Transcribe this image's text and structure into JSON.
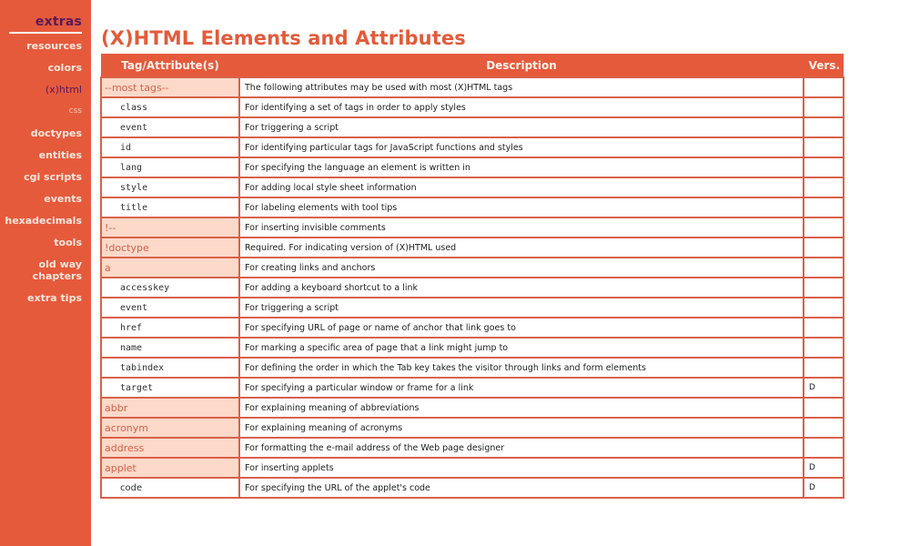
{
  "sidebar": {
    "current": "extras",
    "items": [
      {
        "label": "resources",
        "style": "normal"
      },
      {
        "label": "colors",
        "style": "normal"
      },
      {
        "label": "(x)html",
        "style": "active"
      },
      {
        "label": "css",
        "style": "small"
      },
      {
        "label": "doctypes",
        "style": "normal"
      },
      {
        "label": "entities",
        "style": "normal"
      },
      {
        "label": "cgi scripts",
        "style": "normal"
      },
      {
        "label": "events",
        "style": "normal"
      },
      {
        "label": "hexadecimals",
        "style": "normal"
      },
      {
        "label": "tools",
        "style": "normal"
      },
      {
        "label": "old way chapters",
        "style": "normal"
      },
      {
        "label": "extra tips",
        "style": "normal"
      }
    ]
  },
  "page": {
    "title": "(X)HTML Elements and Attributes"
  },
  "table": {
    "headers": [
      "Tag/Attribute(s)",
      "Description",
      "Vers."
    ],
    "rows": [
      {
        "name": "--most tags--",
        "kind": "tag",
        "desc": "The following attributes may be used with most (X)HTML tags",
        "vers": ""
      },
      {
        "name": "class",
        "kind": "attr",
        "desc": "For identifying a set of tags in order to apply styles",
        "vers": ""
      },
      {
        "name": "event",
        "kind": "attr",
        "desc": "For triggering a script",
        "vers": ""
      },
      {
        "name": "id",
        "kind": "attr",
        "desc": "For identifying particular tags for JavaScript functions and styles",
        "vers": ""
      },
      {
        "name": "lang",
        "kind": "attr",
        "desc": "For specifying the language an element is written in",
        "vers": ""
      },
      {
        "name": "style",
        "kind": "attr",
        "desc": "For adding local style sheet information",
        "vers": ""
      },
      {
        "name": "title",
        "kind": "attr",
        "desc": "For labeling elements with tool tips",
        "vers": ""
      },
      {
        "name": "!--",
        "kind": "tag",
        "desc": "For inserting invisible comments",
        "vers": ""
      },
      {
        "name": "!doctype",
        "kind": "tag",
        "desc": "Required. For indicating version of (X)HTML used",
        "vers": ""
      },
      {
        "name": "a",
        "kind": "tag",
        "desc": "For creating links and anchors",
        "vers": ""
      },
      {
        "name": "accesskey",
        "kind": "attr",
        "desc": "For adding a keyboard shortcut to a link",
        "vers": ""
      },
      {
        "name": "event",
        "kind": "attr",
        "desc": "For triggering a script",
        "vers": ""
      },
      {
        "name": "href",
        "kind": "attr",
        "desc": "For specifying URL of page or name of anchor that link goes to",
        "vers": ""
      },
      {
        "name": "name",
        "kind": "attr",
        "desc": "For marking a specific area of page that a link might jump to",
        "vers": ""
      },
      {
        "name": "tabindex",
        "kind": "attr",
        "desc": "For defining the order in which the Tab key takes the visitor through links and form elements",
        "vers": ""
      },
      {
        "name": "target",
        "kind": "attr",
        "desc": "For specifying a particular window or frame for a link",
        "vers": "D"
      },
      {
        "name": "abbr",
        "kind": "tag",
        "desc": "For explaining meaning of abbreviations",
        "vers": ""
      },
      {
        "name": "acronym",
        "kind": "tag",
        "desc": "For explaining meaning of acronyms",
        "vers": ""
      },
      {
        "name": "address",
        "kind": "tag",
        "desc": "For formatting the e-mail address of the Web page designer",
        "vers": ""
      },
      {
        "name": "applet",
        "kind": "tag",
        "desc": "For inserting applets",
        "vers": "D"
      },
      {
        "name": "code",
        "kind": "attr-alt",
        "desc": "For specifying the URL of the applet's code",
        "vers": "D"
      }
    ]
  }
}
